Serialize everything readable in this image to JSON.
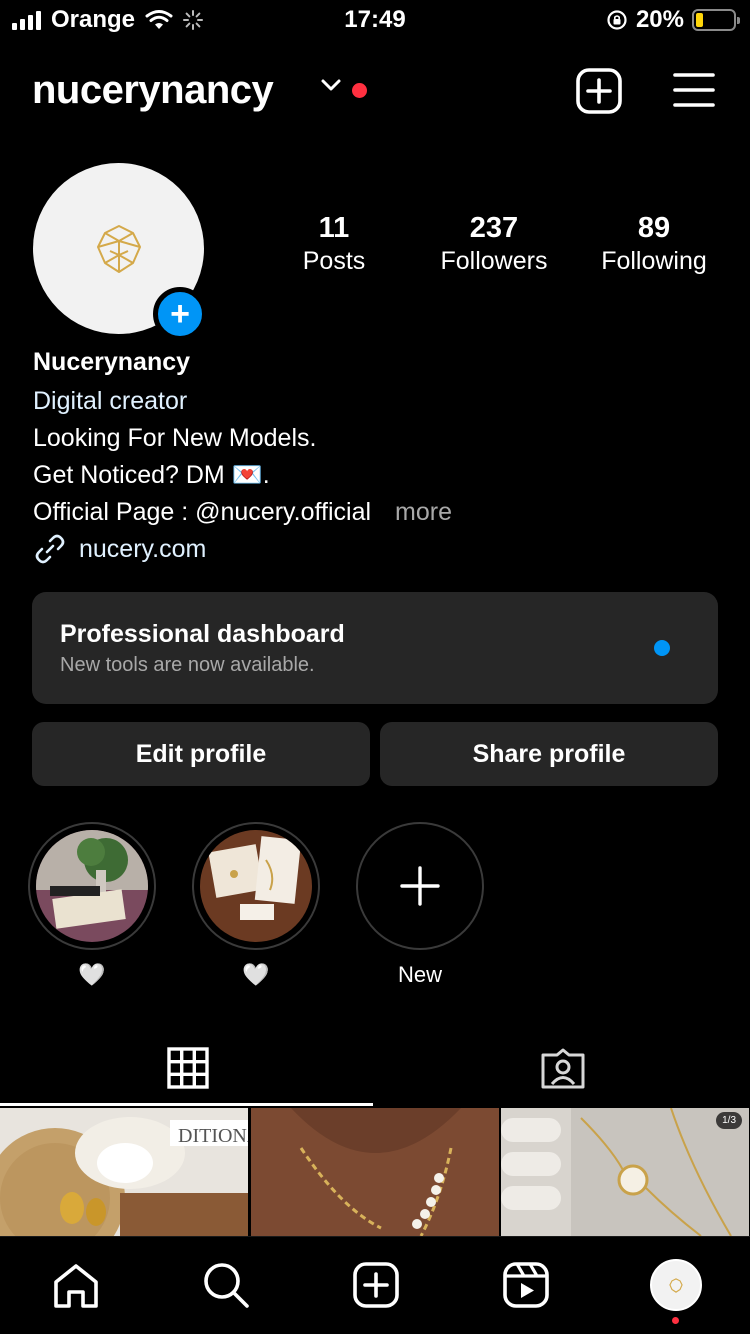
{
  "status_bar": {
    "carrier": "Orange",
    "time": "17:49",
    "battery_percent": "20%",
    "battery_level": 0.2
  },
  "header": {
    "username": "nucerynancy",
    "icons": [
      "chevron-down-icon",
      "new-post-icon",
      "menu-icon"
    ]
  },
  "profile": {
    "stats": [
      {
        "value": "11",
        "label": "Posts"
      },
      {
        "value": "237",
        "label": "Followers"
      },
      {
        "value": "89",
        "label": "Following"
      }
    ],
    "name": "Nucerynancy",
    "category": "Digital creator",
    "bio_lines": [
      "Looking For New Models.",
      "Get Noticed? DM 💌.",
      "Official Page : @nucery.official"
    ],
    "more_label": "more",
    "link": "nucery.com"
  },
  "dashboard": {
    "title": "Professional dashboard",
    "subtitle": "New tools are now available."
  },
  "buttons": {
    "edit": "Edit profile",
    "share": "Share profile"
  },
  "highlights": [
    {
      "label": "🤍"
    },
    {
      "label": "🤍"
    },
    {
      "label": "New"
    }
  ],
  "grid": {
    "multi_badge": "1/3"
  },
  "colors": {
    "accent": "#0095f6",
    "notification": "#ff3040",
    "surface": "#262626",
    "link": "#e0f1ff"
  }
}
